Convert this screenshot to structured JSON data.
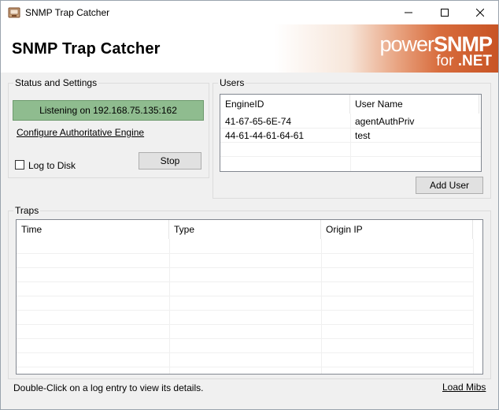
{
  "window": {
    "title": "SNMP Trap Catcher",
    "icon": "snmp-app-icon"
  },
  "banner": {
    "title": "SNMP Trap Catcher",
    "logo_prefix": "power",
    "logo_brand": "SNMP",
    "logo_sub_prefix": "for",
    "logo_sub_brand": ".NET"
  },
  "status_group": {
    "label": "Status and Settings",
    "status_text": "Listening on 192.168.75.135:162",
    "status_color": "#8fbc8f",
    "configure_link": "Configure Authoritative Engine",
    "log_to_disk_label": "Log to Disk",
    "log_to_disk_checked": false,
    "stop_label": "Stop"
  },
  "users_group": {
    "label": "Users",
    "columns": [
      "EngineID",
      "User Name"
    ],
    "rows": [
      [
        "41-67-65-6E-74",
        "agentAuthPriv"
      ],
      [
        "44-61-44-61-64-61",
        "test"
      ]
    ],
    "add_user_label": "Add User"
  },
  "traps_group": {
    "label": "Traps",
    "columns": [
      "Time",
      "Type",
      "Origin IP"
    ],
    "rows": []
  },
  "footer": {
    "hint": "Double-Click on a log entry to view its details.",
    "load_mibs_label": "Load Mibs"
  },
  "colors": {
    "banner_accent": "#c85424"
  }
}
